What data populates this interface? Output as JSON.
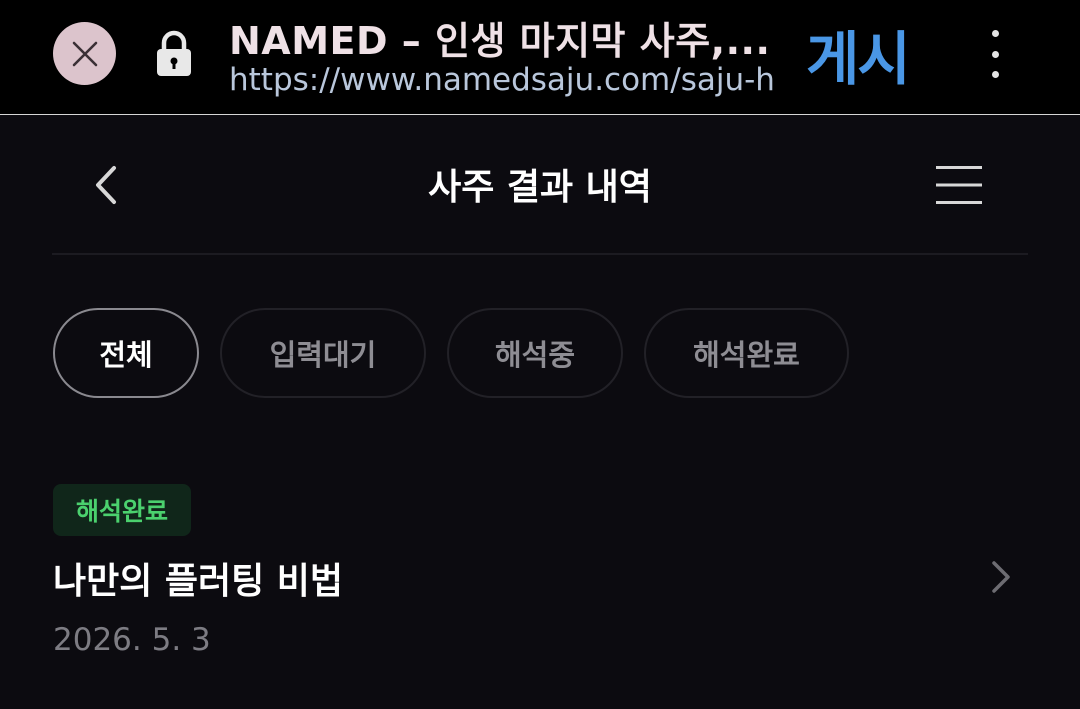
{
  "browser": {
    "tab_title": "NAMED – 인생 마지막 사주,...",
    "url": "https://www.namedsaju.com/saju-h",
    "post_label": "게시",
    "accent": "#4a97e6"
  },
  "header": {
    "title": "사주 결과 내역"
  },
  "filters": [
    {
      "label": "전체",
      "active": true
    },
    {
      "label": "입력대기",
      "active": false
    },
    {
      "label": "해석중",
      "active": false
    },
    {
      "label": "해석완료",
      "active": false
    }
  ],
  "results": [
    {
      "status": "해석완료",
      "status_color": "#4bd16e",
      "title": "나만의 플러팅 비법",
      "date": "2026. 5. 3"
    }
  ]
}
